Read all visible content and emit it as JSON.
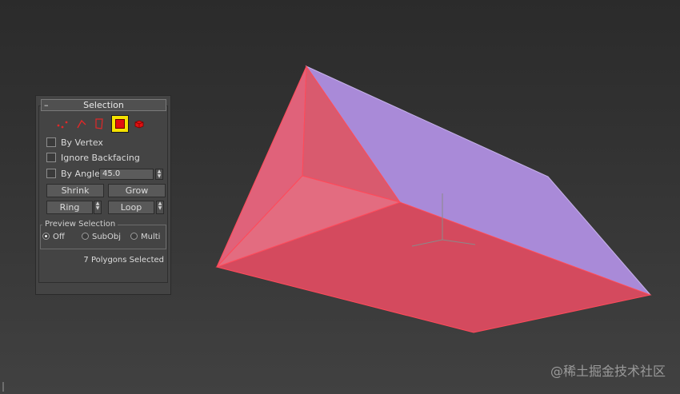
{
  "selection_panel": {
    "title": "Selection",
    "collapse_symbol": "–",
    "subobject_modes": [
      {
        "icon": "vertex-icon"
      },
      {
        "icon": "edge-icon"
      },
      {
        "icon": "border-icon"
      },
      {
        "icon": "polygon-icon",
        "active": true
      },
      {
        "icon": "element-icon"
      }
    ],
    "by_vertex_label": "By Vertex",
    "ignore_backfacing_label": "Ignore Backfacing",
    "by_angle_label": "By Angle:",
    "by_angle_value": "45.0",
    "shrink_label": "Shrink",
    "grow_label": "Grow",
    "ring_label": "Ring",
    "loop_label": "Loop",
    "preview_selection_label": "Preview Selection",
    "preview_options": [
      "Off",
      "SubObj",
      "Multi"
    ],
    "preview_selected": "Off",
    "status": "7 Polygons Selected"
  },
  "watermark": "@稀土掘金技术社区",
  "colors": {
    "selected_face": "#e0556a",
    "unselected_face": "#a98ad8",
    "active_mode": "#f5e200"
  }
}
